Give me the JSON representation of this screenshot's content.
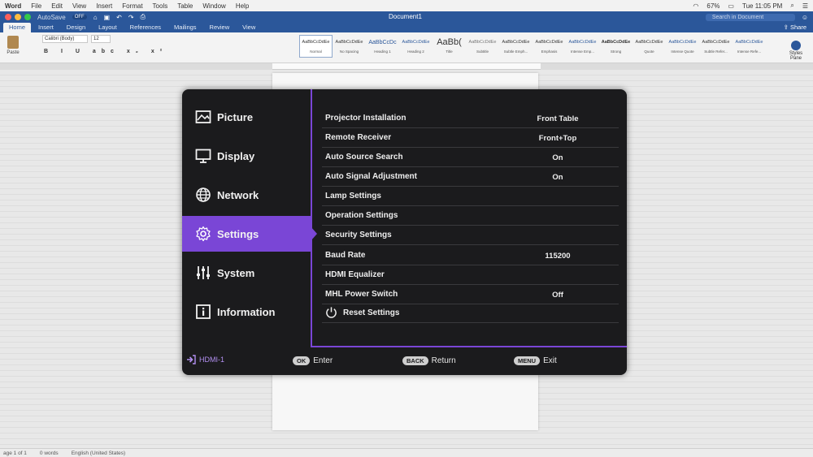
{
  "mac_menu": {
    "items": [
      "Word",
      "File",
      "Edit",
      "View",
      "Insert",
      "Format",
      "Tools",
      "Table",
      "Window",
      "Help"
    ],
    "battery": "67%",
    "clock": "Tue 11:05 PM"
  },
  "word": {
    "autosave": "AutoSave",
    "autosave_state": "OFF",
    "doc_title": "Document1",
    "search_placeholder": "Search in Document",
    "tabs": [
      "Home",
      "Insert",
      "Design",
      "Layout",
      "References",
      "Mailings",
      "Review",
      "View"
    ],
    "share_label": "Share",
    "paste_label": "Paste",
    "font_name": "Calibri (Body)",
    "font_size": "12",
    "format_glyphs": "B I U abc x₂ x²",
    "styles": [
      {
        "preview": "AaBbCcDdEe",
        "name": "Normal"
      },
      {
        "preview": "AaBbCcDdEe",
        "name": "No Spacing"
      },
      {
        "preview": "AaBbCcDc",
        "name": "Heading 1"
      },
      {
        "preview": "AaBbCcDdEe",
        "name": "Heading 2"
      },
      {
        "preview": "AaBb(",
        "name": "Title"
      },
      {
        "preview": "AaBbCcDdEe",
        "name": "Subtitle"
      },
      {
        "preview": "AaBbCcDdEe",
        "name": "Subtle Emph..."
      },
      {
        "preview": "AaBbCcDdEe",
        "name": "Emphasis"
      },
      {
        "preview": "AaBbCcDdEe",
        "name": "Intense Emp..."
      },
      {
        "preview": "AaBbCcDdEe",
        "name": "Strong"
      },
      {
        "preview": "AaBbCcDdEe",
        "name": "Quote"
      },
      {
        "preview": "AaBbCcDdEe",
        "name": "Intense Quote"
      },
      {
        "preview": "AaBbCcDdEe",
        "name": "Subtle Refer..."
      },
      {
        "preview": "AaBbCcDdEe",
        "name": "Intense Refe..."
      }
    ],
    "styles_pane": "Styles Pane",
    "status": {
      "page": "age 1 of 1",
      "words": "0 words",
      "language": "English (United States)"
    }
  },
  "osd": {
    "accent": "#7a46d6",
    "menu": [
      {
        "label": "Picture",
        "icon": "picture-icon"
      },
      {
        "label": "Display",
        "icon": "monitor-icon"
      },
      {
        "label": "Network",
        "icon": "globe-icon"
      },
      {
        "label": "Settings",
        "icon": "gear-icon"
      },
      {
        "label": "System",
        "icon": "sliders-icon"
      },
      {
        "label": "Information",
        "icon": "info-icon"
      }
    ],
    "active_menu": "Settings",
    "rows": [
      {
        "label": "Projector Installation",
        "value": "Front Table"
      },
      {
        "label": "Remote Receiver",
        "value": "Front+Top"
      },
      {
        "label": "Auto Source Search",
        "value": "On"
      },
      {
        "label": "Auto Signal Adjustment",
        "value": "On"
      },
      {
        "label": "Lamp Settings",
        "value": ""
      },
      {
        "label": "Operation Settings",
        "value": ""
      },
      {
        "label": "Security Settings",
        "value": ""
      },
      {
        "label": "Baud Rate",
        "value": "115200"
      },
      {
        "label": "HDMI Equalizer",
        "value": ""
      },
      {
        "label": "MHL Power Switch",
        "value": "Off"
      },
      {
        "label": "Reset Settings",
        "value": ""
      }
    ],
    "footer": {
      "source": "HDMI-1",
      "ok_key": "OK",
      "ok_action": "Enter",
      "back_key": "BACK",
      "back_action": "Return",
      "menu_key": "MENU",
      "menu_action": "Exit"
    }
  }
}
